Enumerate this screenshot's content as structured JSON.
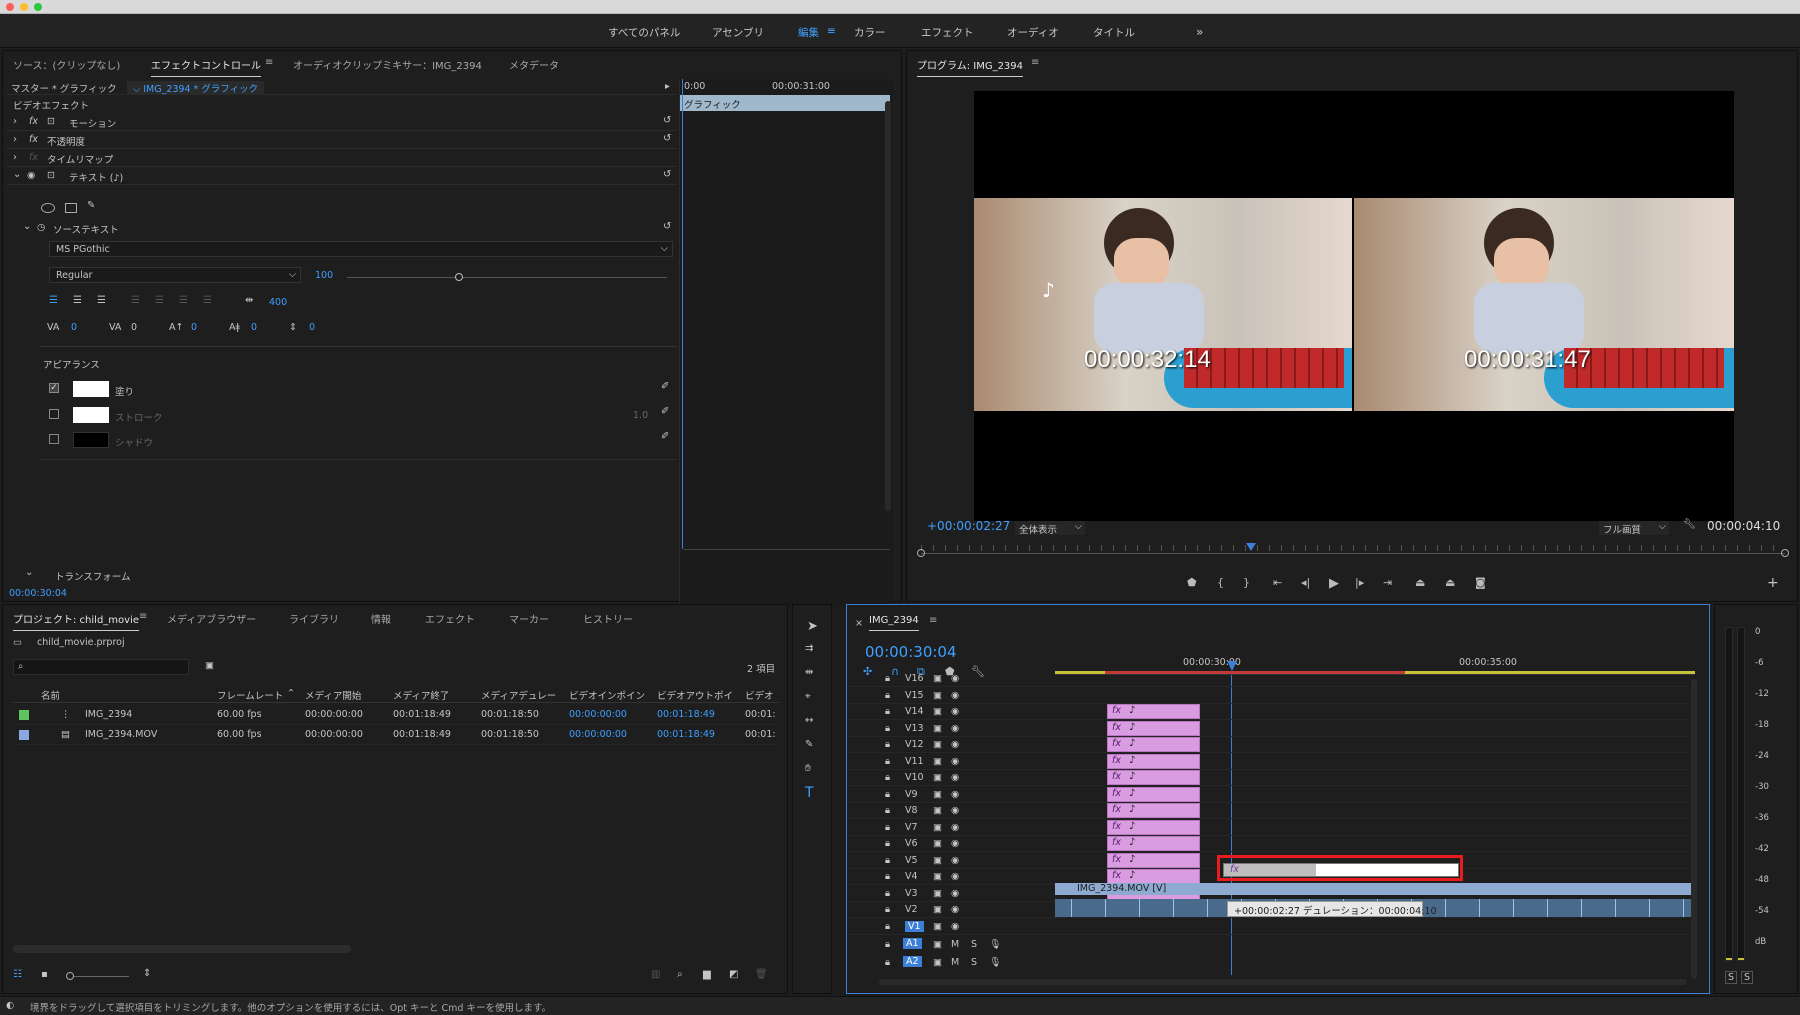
{
  "workspace": {
    "tabs": [
      "すべてのパネル",
      "アセンブリ",
      "編集",
      "カラー",
      "エフェクト",
      "オーディオ",
      "タイトル"
    ],
    "more": "»"
  },
  "effect_panel": {
    "tabs": [
      "ソース：(クリップなし)",
      "エフェクトコントロール",
      "オーディオクリップミキサー：IMG_2394",
      "メタデータ"
    ],
    "master": "マスター * グラフィック",
    "clip": "IMG_2394 * グラフィック",
    "ruler_start": "0:00",
    "ruler_mid": "00:00:31:00",
    "clip_bar": "グラフィック",
    "video_effects": "ビデオエフェクト",
    "motion": "モーション",
    "opacity": "不透明度",
    "time_remap": "タイムリマップ",
    "text_layer": "テキスト (♪)",
    "source_text": "ソーステキスト",
    "font": "MS PGothic",
    "style": "Regular",
    "font_size": "100",
    "font_size_fraction": 0.35,
    "tracking": "400",
    "kern": "0",
    "track2": "0",
    "baseline": "0",
    "tsume": "0",
    "leading": "0",
    "appearance": "アピアランス",
    "fill": "塗り",
    "stroke": "ストローク",
    "stroke_width": "1.0",
    "shadow": "シャドウ",
    "transform": "トランスフォーム",
    "timecode": "00:00:30:04"
  },
  "program": {
    "title": "プログラム: IMG_2394",
    "timecode_left": "+00:00:02:27",
    "fit": "全体表示",
    "quality": "フル画質",
    "duration": "00:00:04:10",
    "overlay_left": "00:00:32:14",
    "overlay_right": "00:00:31:47",
    "note_glyph": "♪"
  },
  "project": {
    "tabs": [
      "プロジェクト: child_movie",
      "メディアブラウザー",
      "ライブラリ",
      "情報",
      "エフェクト",
      "マーカー",
      "ヒストリー"
    ],
    "file": "child_movie.prproj",
    "count": "2 項目",
    "columns": [
      "名前",
      "フレームレート",
      "メディア開始",
      "メディア終了",
      "メディアデュレー",
      "ビデオインポイン",
      "ビデオアウトポイ",
      "ビデオ"
    ],
    "rows": [
      {
        "name": "IMG_2394",
        "fps": "60.00 fps",
        "start": "00:00:00:00",
        "end": "00:01:18:49",
        "dur": "00:01:18:50",
        "vin": "00:00:00:00",
        "vout": "00:01:18:49",
        "v": "00:01:",
        "color": "#5fc35f"
      },
      {
        "name": "IMG_2394.MOV",
        "fps": "60.00 fps",
        "start": "00:00:00:00",
        "end": "00:01:18:49",
        "dur": "00:01:18:50",
        "vin": "00:00:00:00",
        "vout": "00:01:18:49",
        "v": "00:01:",
        "color": "#8aa8e0"
      }
    ]
  },
  "timeline": {
    "title": "IMG_2394",
    "timecode": "00:00:30:04",
    "ruler": [
      "00:00:30:00",
      "00:00:35:00"
    ],
    "tracks": [
      "V16",
      "V15",
      "V14",
      "V13",
      "V12",
      "V11",
      "V10",
      "V9",
      "V8",
      "V7",
      "V6",
      "V5",
      "V4",
      "V3",
      "V2",
      "V1"
    ],
    "audio_tracks": [
      "A1",
      "A2"
    ],
    "v1_clip": "IMG_2394.MOV [V]",
    "tooltip": "+00:00:02:27 デュレーション：00:00:04:10",
    "fx": "fx",
    "M": "M",
    "S": "S"
  },
  "meter": {
    "labels": [
      "0",
      "-6",
      "-12",
      "-18",
      "-24",
      "-30",
      "-36",
      "-42",
      "-48",
      "-54",
      "dB"
    ],
    "solo": [
      "S",
      "S"
    ]
  },
  "status": "境界をドラッグして選択項目をトリミングします。他のオプションを使用するには、Opt キーと Cmd キーを使用します。"
}
